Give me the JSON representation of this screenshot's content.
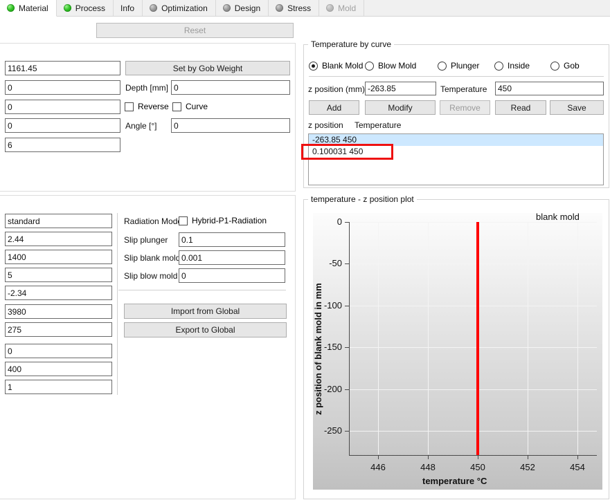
{
  "tabs": [
    {
      "label": "Material",
      "led": "green-led-icon",
      "state": "active"
    },
    {
      "label": "Process",
      "led": "green-led-icon",
      "state": "normal"
    },
    {
      "label": "Info",
      "led": "none",
      "state": "normal"
    },
    {
      "label": "Optimization",
      "led": "gray-led-icon",
      "state": "normal"
    },
    {
      "label": "Design",
      "led": "gray-led-icon",
      "state": "normal"
    },
    {
      "label": "Stress",
      "led": "gray-led-icon",
      "state": "normal"
    },
    {
      "label": "Mold",
      "led": "gray-led-icon",
      "state": "disabled"
    }
  ],
  "toolbar": {
    "left_button_label": "",
    "reset_label": "Reset"
  },
  "geometry_panel": {
    "weight_value": "1161.45",
    "set_by_gob_weight_label": "Set by Gob Weight",
    "row2_value": "0",
    "depth_label": "Depth [mm]",
    "depth_value": "0",
    "row3_value": "0",
    "reverse_label": "Reverse",
    "curve_label": "Curve",
    "row4_value": "0",
    "angle_label": "Angle [°]",
    "angle_value": "0",
    "row5_value": "6"
  },
  "material_panel": {
    "fields": [
      "standard",
      "2.44",
      "1400",
      "5",
      "-2.34",
      "3980",
      "275",
      "0",
      "400",
      "1"
    ],
    "radiation_model_label": "Radiation Model",
    "hybrid_p1_label": "Hybrid-P1-Radiation",
    "slip_plunger_label": "Slip plunger",
    "slip_plunger_value": "0.1",
    "slip_blank_mold_label": "Slip blank mold",
    "slip_blank_mold_value": "0.001",
    "slip_blow_mold_label": "Slip blow mold",
    "slip_blow_mold_value": "0",
    "import_label": "Import from Global",
    "export_label": "Export to Global"
  },
  "temperature_group": {
    "title": "Temperature by curve",
    "radios": [
      {
        "label": "Blank Mold",
        "selected": true
      },
      {
        "label": "Blow Mold",
        "selected": false
      },
      {
        "label": "Plunger",
        "selected": false
      },
      {
        "label": "Inside",
        "selected": false
      },
      {
        "label": "Gob",
        "selected": false
      }
    ],
    "z_position_label": "z position (mm)",
    "z_position_value": "-263.85",
    "temperature_label": "Temperature",
    "temperature_value": "450",
    "buttons": [
      {
        "label": "Add",
        "enabled": true
      },
      {
        "label": "Modify",
        "enabled": true
      },
      {
        "label": "Remove",
        "enabled": false
      },
      {
        "label": "Read",
        "enabled": true
      },
      {
        "label": "Save",
        "enabled": true
      }
    ],
    "list_header_z": "z position",
    "list_header_t": "Temperature",
    "rows": [
      {
        "text": "-263.85 450",
        "selected": true,
        "highlighted": false
      },
      {
        "text": "0.100031 450",
        "selected": false,
        "highlighted": true
      }
    ]
  },
  "plot_group": {
    "title": "temperature - z position plot"
  },
  "chart_data": {
    "type": "line",
    "title": "temperature - z position plot",
    "xlabel": "temperature °C",
    "ylabel": "z position of blank mold in mm",
    "legend": [
      "blank mold"
    ],
    "legend_position": "top-right",
    "grid": true,
    "xlim": [
      444.7,
      455.3
    ],
    "ylim": [
      -272,
      6
    ],
    "xticks": [
      446,
      448,
      450,
      452,
      454
    ],
    "yticks": [
      0,
      -50,
      -100,
      -150,
      -200,
      -250
    ],
    "series": [
      {
        "name": "blank mold",
        "color": "#ff0000",
        "x": [
          450,
          450
        ],
        "y": [
          0.100031,
          -263.85
        ]
      }
    ]
  },
  "colors": {
    "accent_red": "#ff0000",
    "selection_blue": "#cde8ff",
    "led_green": "#2ec41f",
    "button_face": "#e6e6e6"
  }
}
